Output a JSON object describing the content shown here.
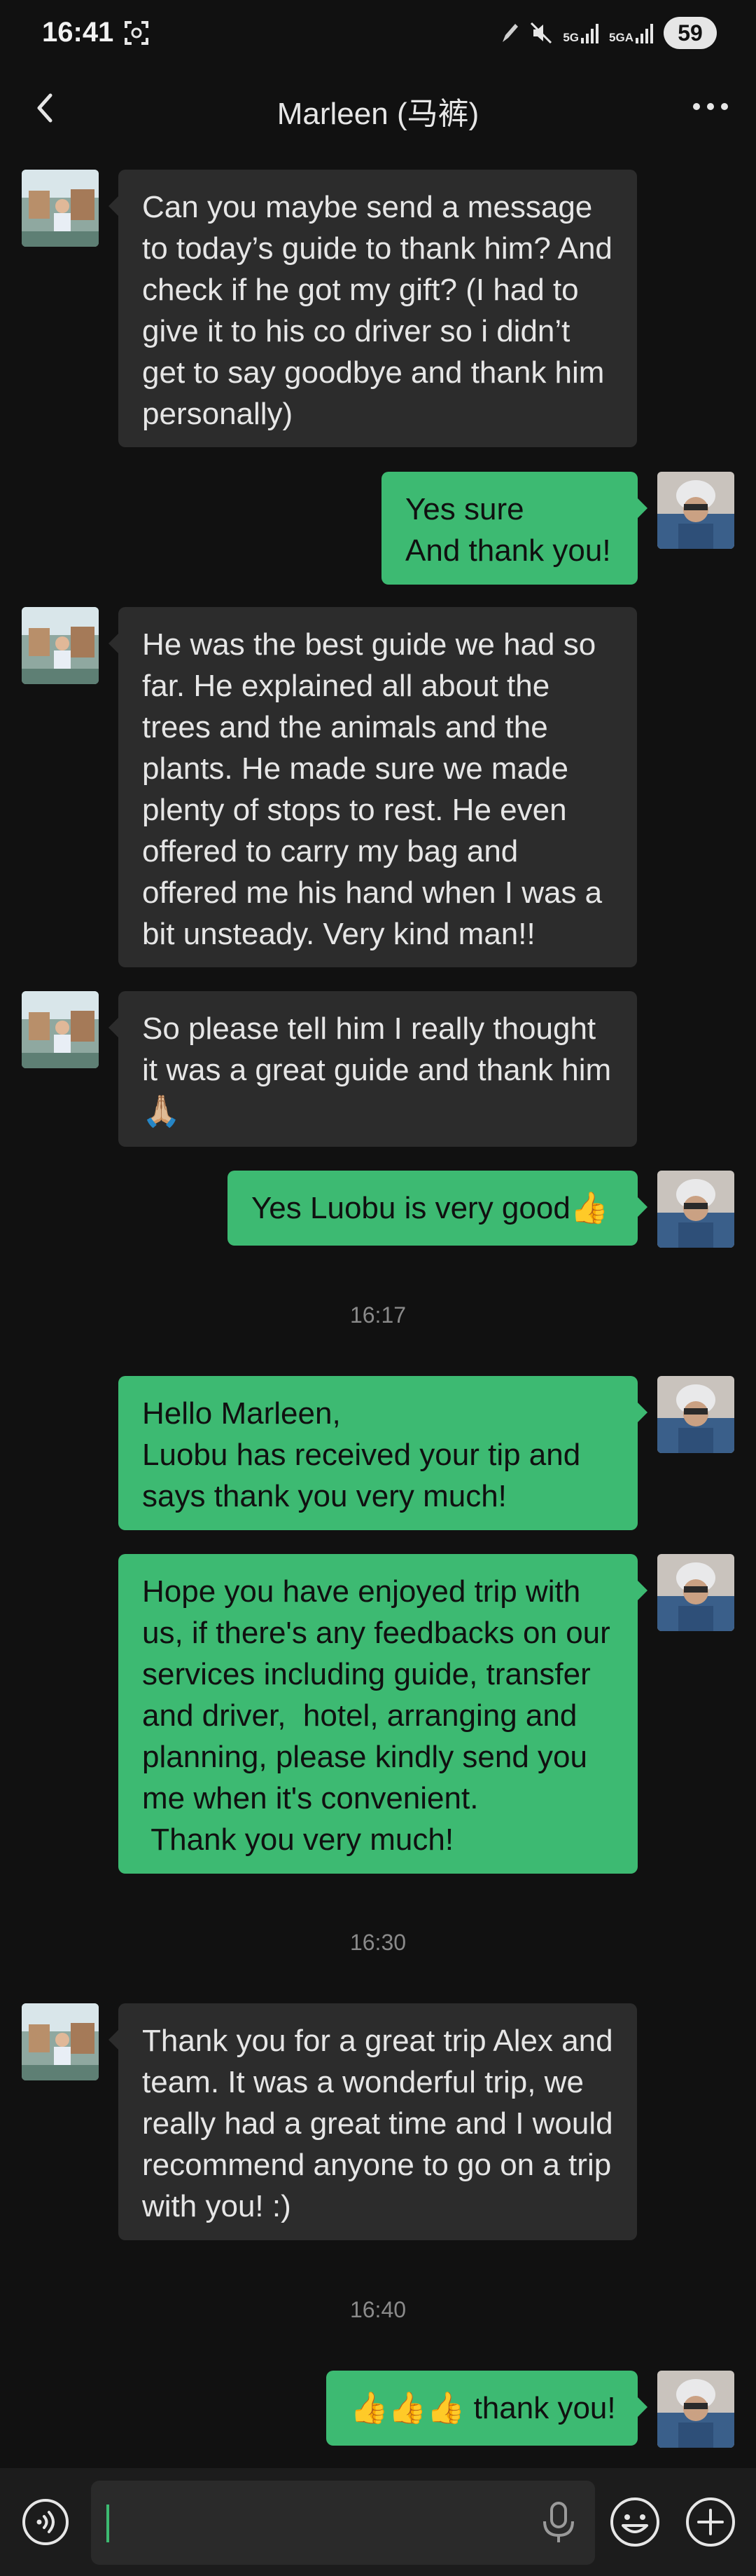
{
  "status_bar": {
    "time": "16:41",
    "network_1": "5G",
    "network_2": "5GA",
    "battery": "59"
  },
  "header": {
    "title": "Marleen (马裤)"
  },
  "messages": [
    {
      "sender": "other",
      "text": "Can you maybe send a message to today’s guide to thank him? And check if he got my gift? (I had to give it to his co driver so i didn’t get to say goodbye and thank him personally)"
    },
    {
      "sender": "me",
      "text": "Yes sure\nAnd thank you!"
    },
    {
      "sender": "other",
      "text": "He was the best guide we had so far. He explained all about the trees and the animals and the plants. He made sure we made plenty of stops to rest. He even offered to carry my bag and offered me his hand when I was a bit unsteady. Very kind man!!"
    },
    {
      "sender": "other",
      "text": "So please tell him I really thought it was a great guide and thank him 🙏🏼"
    },
    {
      "sender": "me",
      "text": "Yes Luobu is very good👍"
    },
    {
      "timestamp": "16:17"
    },
    {
      "sender": "me",
      "text": "Hello Marleen,\nLuobu has received your tip and says thank you very much!"
    },
    {
      "sender": "me",
      "text": "Hope you have enjoyed trip with us, if there's any feedbacks on our services including guide, transfer and driver,  hotel, arranging and planning, please kindly send you me when it's convenient.\n Thank you very much!"
    },
    {
      "timestamp": "16:30"
    },
    {
      "sender": "other",
      "text": "Thank you for a great trip Alex and team. It was a wonderful trip, we really had a great time and I would recommend anyone to go on a trip with you! :)"
    },
    {
      "timestamp": "16:40"
    },
    {
      "sender": "me",
      "text": "👍👍👍 thank you!"
    }
  ],
  "input": {
    "value": ""
  },
  "icons": {
    "back": "chevron-left-icon",
    "more": "more-dots-icon",
    "voice": "voice-mode-icon",
    "mic": "microphone-icon",
    "emoji": "emoji-icon",
    "plus": "plus-icon"
  },
  "colors": {
    "background": "#111111",
    "incoming_bubble": "#2c2c2c",
    "outgoing_bubble": "#3dba72",
    "timestamp": "#8a8a8a"
  }
}
